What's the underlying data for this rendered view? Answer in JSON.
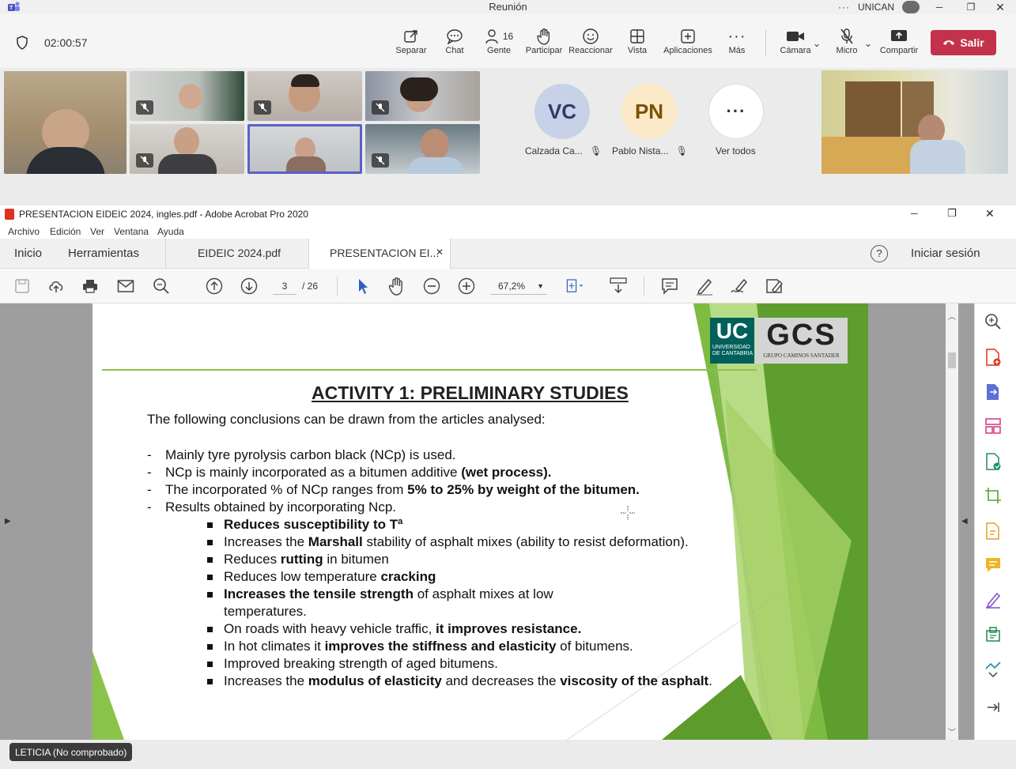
{
  "teams": {
    "window_title": "Reunión",
    "org": "UNICAN",
    "timer": "02:00:57",
    "people_count": "16",
    "toolbar": [
      {
        "label": "Separar",
        "icon": "popout-icon"
      },
      {
        "label": "Chat",
        "icon": "chat-icon"
      },
      {
        "label": "Gente",
        "icon": "people-icon"
      },
      {
        "label": "Participar",
        "icon": "raise-hand-icon"
      },
      {
        "label": "Reaccionar",
        "icon": "smile-icon"
      },
      {
        "label": "Vista",
        "icon": "grid-icon"
      },
      {
        "label": "Aplicaciones",
        "icon": "plus-icon"
      },
      {
        "label": "Más",
        "icon": "more-icon"
      },
      {
        "label": "Cámara",
        "icon": "camera-icon"
      },
      {
        "label": "Micro",
        "icon": "mic-off-icon"
      },
      {
        "label": "Compartir",
        "icon": "share-icon"
      }
    ],
    "leave_label": "Salir",
    "participants": [
      {
        "initials": "VC",
        "name": "Calzada Ca...",
        "color": "#c7d2e8",
        "text_color": "#2b3d66"
      },
      {
        "initials": "PN",
        "name": "Pablo Nista...",
        "color": "#fbe9c7",
        "text_color": "#7a5200"
      }
    ],
    "see_all_label": "Ver todos",
    "presenter_badge": "LETICIA (No comprobado)"
  },
  "acrobat": {
    "window_title": "PRESENTACION EIDEIC 2024, ingles.pdf - Adobe Acrobat Pro 2020",
    "menu": [
      "Archivo",
      "Edición",
      "Ver",
      "Ventana",
      "Ayuda"
    ],
    "home_tab": "Inicio",
    "tools_tab": "Herramientas",
    "doc_tabs": [
      {
        "label": "EIDEIC 2024.pdf"
      },
      {
        "label": "PRESENTACION EI..."
      }
    ],
    "help_label": "?",
    "signin_label": "Iniciar sesión",
    "page_current": "3",
    "page_total": "/ 26",
    "zoom": "67,2%"
  },
  "slide": {
    "logo_uc": "UC",
    "logo_uc_sub1": "UNIVERSIDAD",
    "logo_uc_sub2": "DE CANTABRIA",
    "logo_gcs": "GCS",
    "logo_gcs_sub": "GRUPO CAMINOS SANTADER",
    "title": "ACTIVITY 1: PRELIMINARY STUDIES",
    "intro": "The following conclusions can be drawn from the articles analysed:",
    "dash_items": [
      {
        "a": "Mainly tyre pyrolysis carbon black (NCp) is used.",
        "b": "",
        "c": ""
      },
      {
        "a": "NCp is mainly incorporated as a bitumen additive ",
        "b": "(wet process).",
        "c": ""
      },
      {
        "a": "The incorporated % of NCp ranges from ",
        "b": "5% to 25% by weight of the bitumen.",
        "c": ""
      },
      {
        "a": "Results obtained by incorporating Ncp.",
        "b": "",
        "c": ""
      }
    ],
    "bullets": [
      {
        "a": "",
        "b": "Reduces susceptibility to Tª",
        "c": ""
      },
      {
        "a": "Increases the ",
        "b": "Marshall",
        "c": " stability of asphalt mixes (ability to resist deformation)."
      },
      {
        "a": "Reduces ",
        "b": "rutting",
        "c": " in bitumen"
      },
      {
        "a": "Reduces low temperature ",
        "b": "cracking",
        "c": ""
      },
      {
        "a": "",
        "b": "Increases the tensile strength",
        "c": " of asphalt mixes at low"
      },
      {
        "a": "On roads with heavy vehicle traffic, ",
        "b": "it improves resistance.",
        "c": ""
      },
      {
        "a": "In hot climates it ",
        "b": "improves the stiffness and elasticity",
        "c": " of bitumens."
      },
      {
        "a": "Improved breaking strength of aged bitumens.",
        "b": "",
        "c": ""
      },
      {
        "a": "Increases the ",
        "b": "modulus of elasticity",
        "c": " and decreases the "
      }
    ],
    "bullet5_cont": "temperatures.",
    "last_bold": "viscosity of the asphalt",
    "last_end": "."
  }
}
